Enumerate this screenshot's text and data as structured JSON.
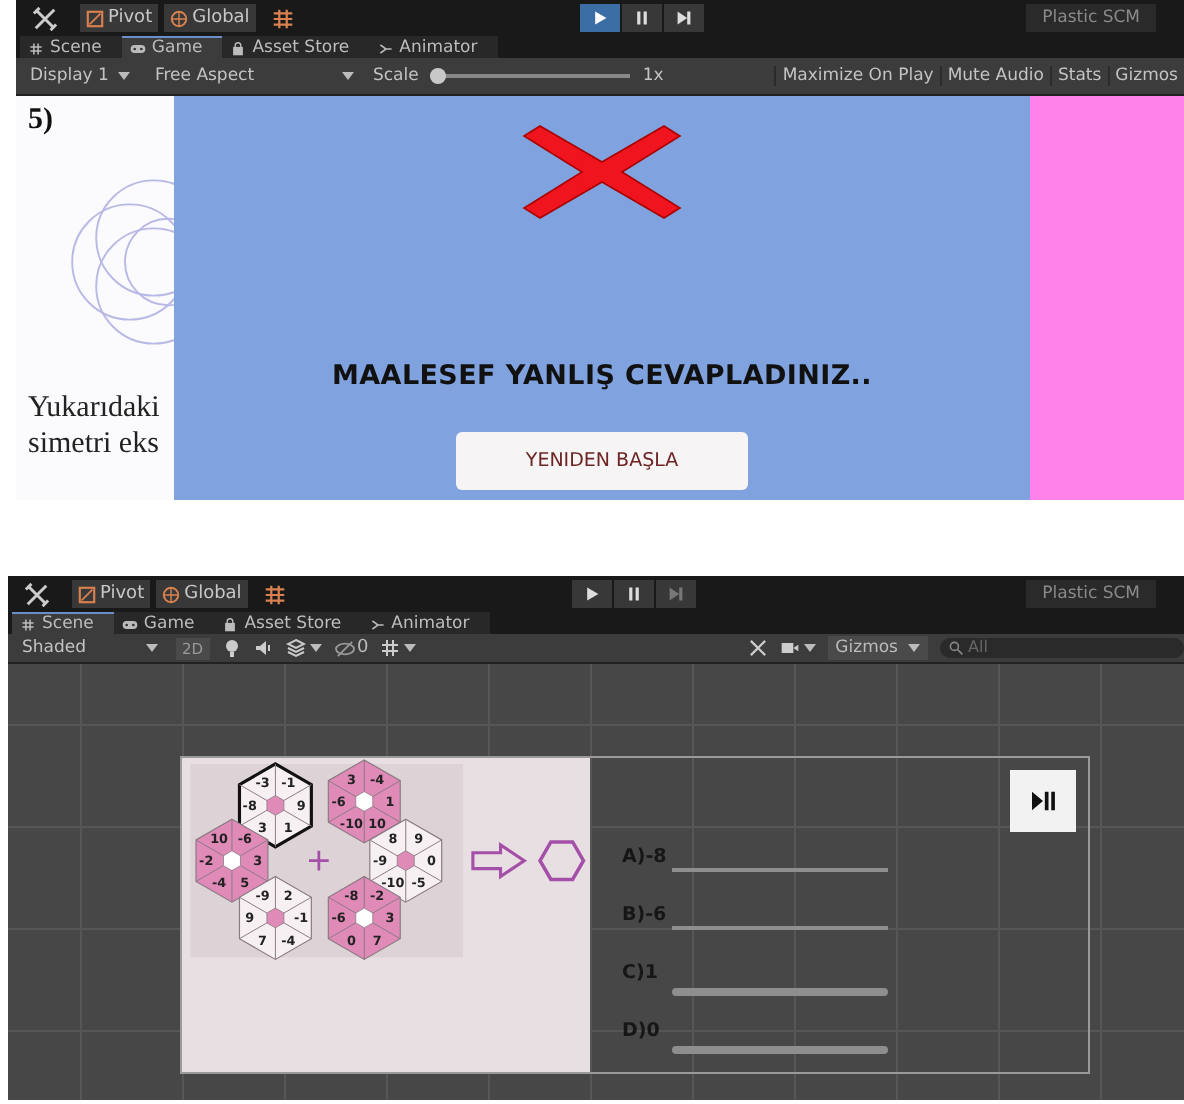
{
  "windows": [
    {
      "kind": "game",
      "toolbar": {
        "tools": [
          {
            "label": "Pivot",
            "kind": "pivot"
          },
          {
            "label": "Global",
            "kind": "global"
          }
        ],
        "playback": [
          {
            "kind": "play",
            "selected": true,
            "disabled": false
          },
          {
            "kind": "pause",
            "selected": false,
            "disabled": false
          },
          {
            "kind": "step",
            "selected": false,
            "disabled": false
          }
        ],
        "plastic_scm": "Plastic SCM"
      },
      "tabs": [
        {
          "label": "Scene",
          "kind": "scene",
          "selected": false
        },
        {
          "label": "Game",
          "kind": "game",
          "selected": true
        },
        {
          "label": "Asset Store",
          "kind": "store",
          "selected": false
        },
        {
          "label": "Animator",
          "kind": "animator",
          "selected": false
        }
      ],
      "game_bar": {
        "display": "Display 1",
        "aspect": "Free Aspect",
        "scale_label": "Scale",
        "scale": {
          "level": 0
        },
        "scale_value": "1x",
        "options": [
          "Maximize On Play",
          "Mute Audio",
          "Stats",
          "Gizmos"
        ]
      },
      "view": {
        "question_number": "5)",
        "question_lines": [
          "Yukarıdaki",
          "simetri eks"
        ],
        "message": "MAALESEF YANLIŞ CEVAPLADINIZ..",
        "restart_button": "YENIDEN BAŞLA"
      }
    },
    {
      "kind": "scene",
      "toolbar": {
        "tools": [
          {
            "label": "Pivot",
            "kind": "pivot"
          },
          {
            "label": "Global",
            "kind": "global"
          }
        ],
        "playback": [
          {
            "kind": "play",
            "selected": false,
            "disabled": false
          },
          {
            "kind": "pause",
            "selected": false,
            "disabled": false
          },
          {
            "kind": "step",
            "selected": false,
            "disabled": true
          }
        ],
        "plastic_scm": "Plastic SCM"
      },
      "tabs": [
        {
          "label": "Scene",
          "kind": "scene",
          "selected": true
        },
        {
          "label": "Game",
          "kind": "game",
          "selected": false
        },
        {
          "label": "Asset Store",
          "kind": "store",
          "selected": false
        },
        {
          "label": "Animator",
          "kind": "animator",
          "selected": false
        }
      ],
      "scene_bar": {
        "shading": "Shaded",
        "mode_2d": "2D",
        "hidden_count": "0",
        "gizmos": "Gizmos",
        "search": {
          "placeholder": "All"
        }
      },
      "canvas": {
        "hexagons": [
          {
            "values": [
              "-3",
              "-1",
              "9",
              "1",
              "3",
              "-8"
            ],
            "shaded": false,
            "highlighted": true
          },
          {
            "values": [
              "3",
              "-4",
              "1",
              "10",
              "-10",
              "-6"
            ],
            "shaded": true,
            "highlighted": false
          },
          {
            "values": [
              "10",
              "-6",
              "3",
              "5",
              "-4",
              "-2"
            ],
            "shaded": true,
            "highlighted": false
          },
          {
            "values": [
              "8",
              "9",
              "0",
              "-5",
              "-10",
              "-9"
            ],
            "shaded": false,
            "highlighted": false
          },
          {
            "values": [
              "-9",
              "2",
              "-1",
              "-4",
              "7",
              "9"
            ],
            "shaded": false,
            "highlighted": false
          },
          {
            "values": [
              "-8",
              "-2",
              "3",
              "7",
              "0",
              "-6"
            ],
            "shaded": true,
            "highlighted": false
          }
        ],
        "answers": [
          {
            "label": "A)-8",
            "kind": "line"
          },
          {
            "label": "B)-6",
            "kind": "line"
          },
          {
            "label": "C)1",
            "kind": "bar"
          },
          {
            "label": "D)0",
            "kind": "bar"
          }
        ]
      }
    }
  ]
}
